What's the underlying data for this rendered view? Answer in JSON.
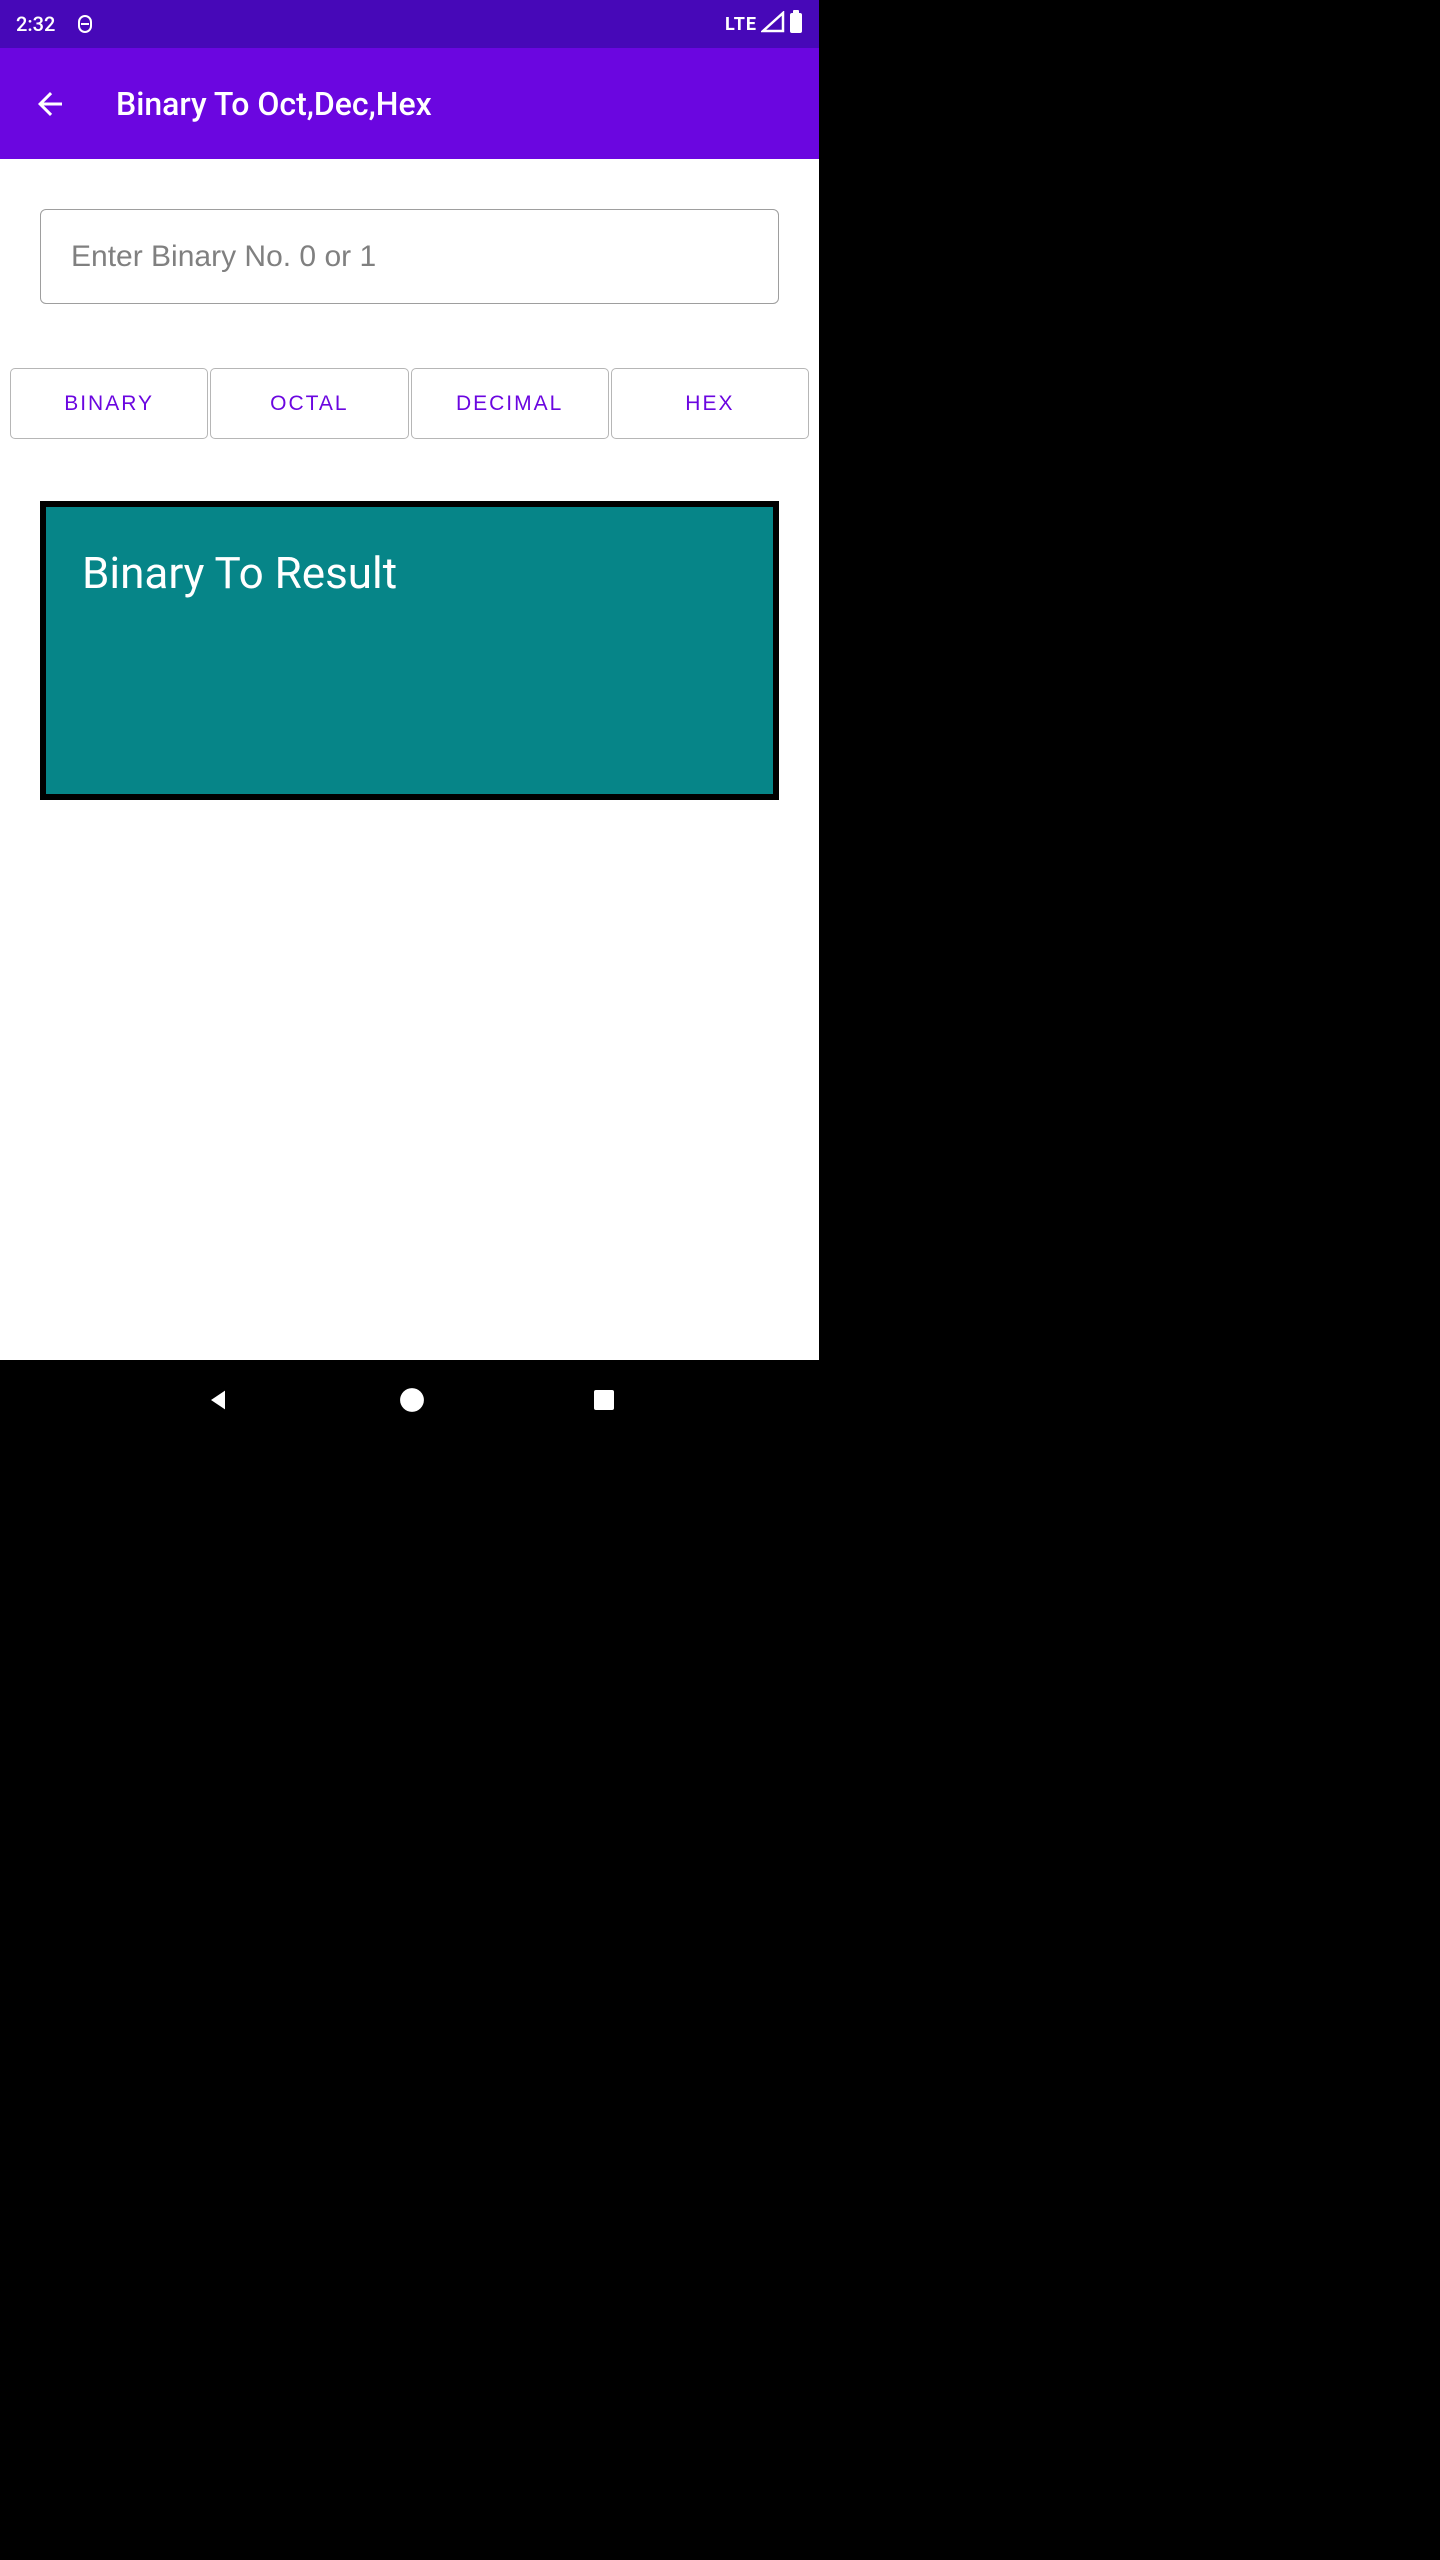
{
  "status": {
    "time": "2:32",
    "lte": "LTE"
  },
  "appbar": {
    "title": "Binary To Oct,Dec,Hex"
  },
  "input": {
    "placeholder": "Enter Binary No. 0 or 1",
    "value": ""
  },
  "buttons": {
    "binary": "BINARY",
    "octal": "OCTAL",
    "decimal": "DECIMAL",
    "hex": "HEX"
  },
  "result": {
    "title": "Binary To Result"
  }
}
